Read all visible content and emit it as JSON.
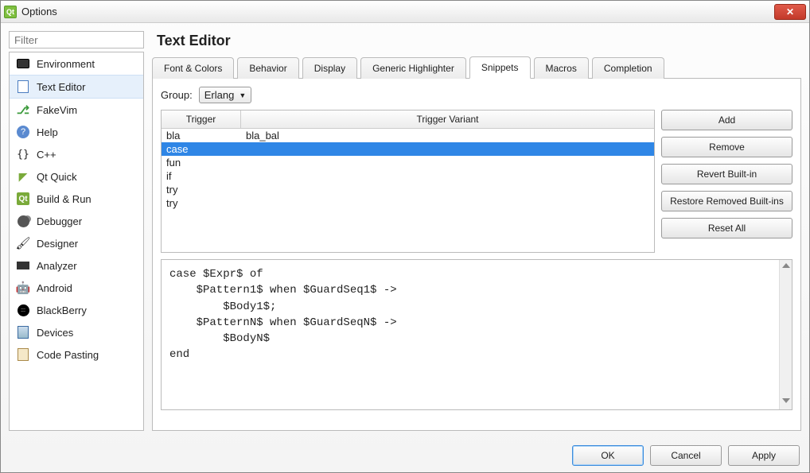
{
  "window": {
    "title": "Options"
  },
  "filter": {
    "placeholder": "Filter"
  },
  "categories": [
    {
      "label": "Environment"
    },
    {
      "label": "Text Editor"
    },
    {
      "label": "FakeVim"
    },
    {
      "label": "Help"
    },
    {
      "label": "C++"
    },
    {
      "label": "Qt Quick"
    },
    {
      "label": "Build & Run"
    },
    {
      "label": "Debugger"
    },
    {
      "label": "Designer"
    },
    {
      "label": "Analyzer"
    },
    {
      "label": "Android"
    },
    {
      "label": "BlackBerry"
    },
    {
      "label": "Devices"
    },
    {
      "label": "Code Pasting"
    }
  ],
  "selected_category_index": 1,
  "page_heading": "Text Editor",
  "tabs": [
    {
      "label": "Font & Colors"
    },
    {
      "label": "Behavior"
    },
    {
      "label": "Display"
    },
    {
      "label": "Generic Highlighter"
    },
    {
      "label": "Snippets"
    },
    {
      "label": "Macros"
    },
    {
      "label": "Completion"
    }
  ],
  "active_tab_index": 4,
  "group": {
    "label": "Group:",
    "value": "Erlang"
  },
  "table": {
    "headers": {
      "trigger": "Trigger",
      "variant": "Trigger Variant"
    },
    "rows": [
      {
        "trigger": "bla",
        "variant": "bla_bal"
      },
      {
        "trigger": "case",
        "variant": ""
      },
      {
        "trigger": "fun",
        "variant": ""
      },
      {
        "trigger": "if",
        "variant": ""
      },
      {
        "trigger": "try",
        "variant": ""
      },
      {
        "trigger": "try",
        "variant": ""
      }
    ],
    "selected_row_index": 1
  },
  "side_buttons": {
    "add": "Add",
    "remove": "Remove",
    "revert": "Revert Built-in",
    "restore": "Restore Removed Built-ins",
    "reset": "Reset All"
  },
  "snippet_code": "case $Expr$ of\n    $Pattern1$ when $GuardSeq1$ ->\n        $Body1$;\n    $PatternN$ when $GuardSeqN$ ->\n        $BodyN$\nend",
  "footer": {
    "ok": "OK",
    "cancel": "Cancel",
    "apply": "Apply"
  }
}
